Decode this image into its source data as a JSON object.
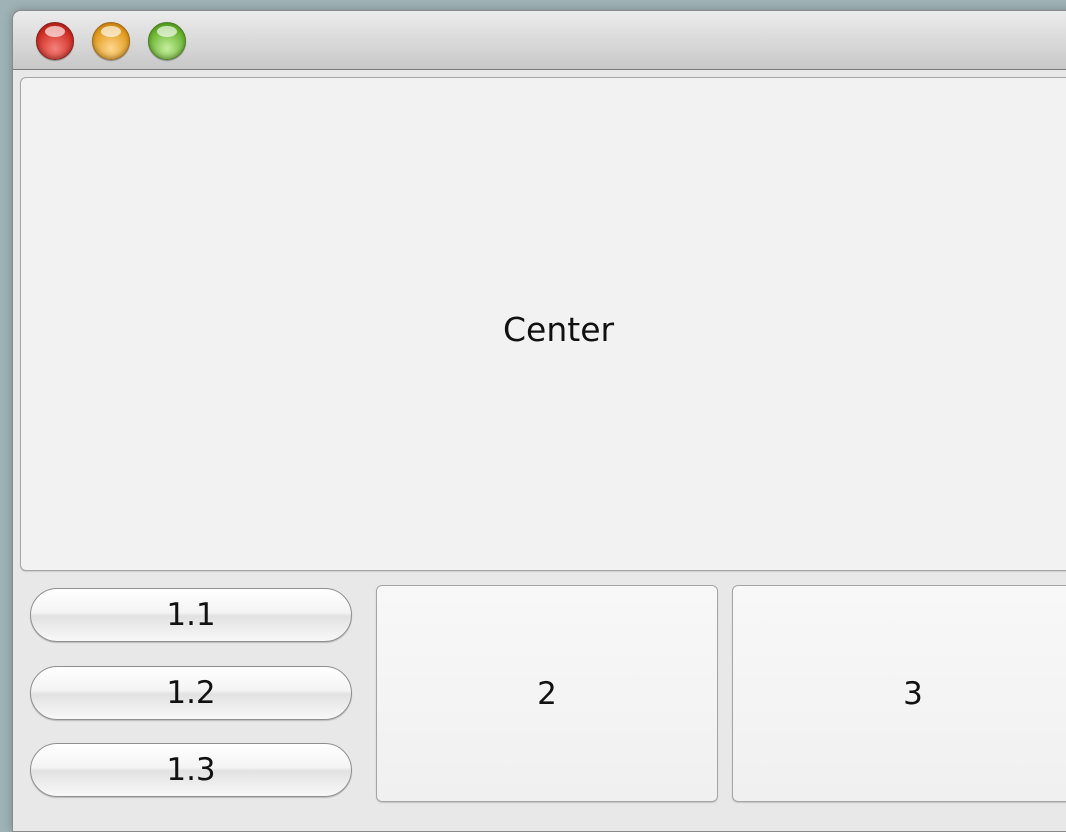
{
  "window": {
    "controls": [
      {
        "name": "close",
        "color": "#cf2a22"
      },
      {
        "name": "minimize",
        "color": "#e19a1c"
      },
      {
        "name": "zoom",
        "color": "#66b22c"
      }
    ]
  },
  "center": {
    "label": "Center"
  },
  "buttons": {
    "b1_1": "1.1",
    "b1_2": "1.2",
    "b1_3": "1.3",
    "b2": "2",
    "b3": "3"
  }
}
